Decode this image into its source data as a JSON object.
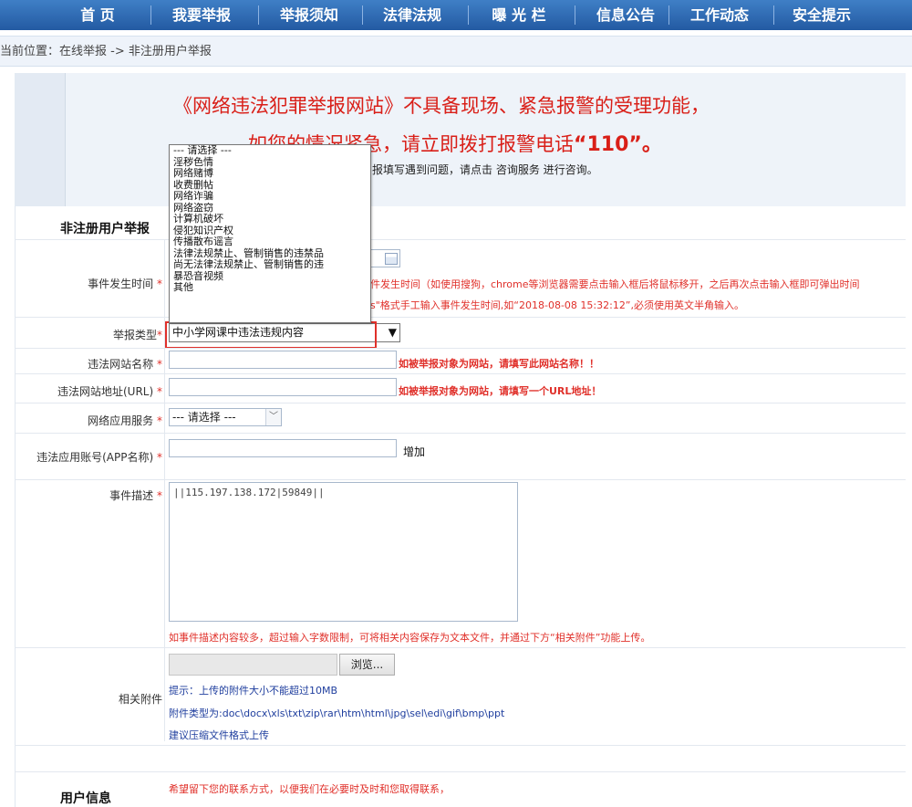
{
  "nav": {
    "items": [
      "首 页",
      "我要举报",
      "举报须知",
      "法律法规",
      "曝 光 栏",
      "信息公告",
      "工作动态",
      "安全提示"
    ]
  },
  "breadcrumb": "当前位置：在线举报 -> 非注册用户举报",
  "notice": {
    "line1": "《网络违法犯罪举报网站》不具备现场、紧急报警的受理功能，",
    "line2_prefix": "如您的情况紧急，请立即拨打报警电话",
    "line2_number": "“110”。",
    "line3": "报填写遇到问题，请点击 咨询服务 进行咨询。"
  },
  "form": {
    "section_title": "非注册用户举报",
    "event_time_label": "事件发生时间",
    "event_time_hint1": "件发生时间（如使用搜狗，chrome等浏览器需要点击输入框后将鼠标移开，之后再次点击输入框即可弹出时间",
    "event_time_hint2": "s\"格式手工输入事件发生时间,如“2018-08-08 15:32:12”,必须使用英文半角输入。",
    "report_type_label": "举报类型",
    "report_type_value": "中小学网课中违法违规内容",
    "report_type_options": [
      "--- 请选择 ---",
      "淫秽色情",
      "网络赌博",
      "收费删帖",
      "网络诈骗",
      "网络盗窃",
      "计算机破坏",
      "侵犯知识产权",
      "传播散布谣言",
      "法律法规禁止、管制销售的违禁品",
      "尚无法律法规禁止、管制销售的违",
      "暴恐音视频",
      "其他"
    ],
    "site_name_label": "违法网站名称",
    "site_name_hint": "如被举报对象为网站，请填写此网站名称！！",
    "site_url_label": "违法网站地址(URL)",
    "site_url_hint": "如被举报对象为网站，请填写一个URL地址！",
    "app_service_label": "网络应用服务",
    "app_service_value": "--- 请选择 ---",
    "app_account_label": "违法应用账号(APP名称)",
    "add_label": "增加",
    "description_label": "事件描述",
    "description_value": "||115.197.138.172|59849||",
    "description_hint": "如事件描述内容较多，超过输入字数限制，可将相关内容保存为文本文件，并通过下方“相关附件”功能上传。",
    "attachment_label": "相关附件",
    "browse_label": "浏览...",
    "attach_tip1": "提示：上传的附件大小不能超过10MB",
    "attach_tip2": "附件类型为:doc\\docx\\xls\\txt\\zip\\rar\\htm\\html\\jpg\\sel\\edi\\gif\\bmp\\ppt",
    "attach_tip3": "建议压缩文件格式上传",
    "user_info_title": "用户信息",
    "user_info_hint": "希望留下您的联系方式，以便我们在必要时及时和您取得联系，",
    "star": "*"
  }
}
